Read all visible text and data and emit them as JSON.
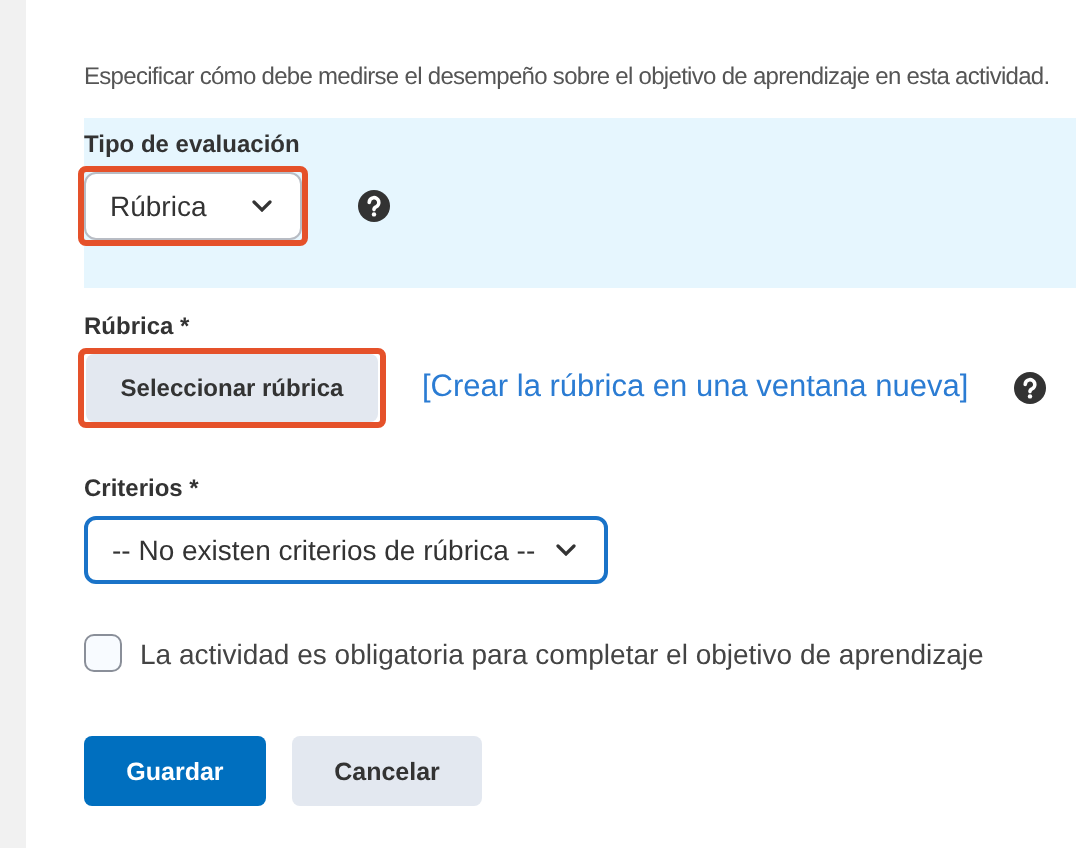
{
  "description": "Especificar cómo debe medirse el desempeño sobre el objetivo de aprendizaje en esta actividad.",
  "assessment_type": {
    "label": "Tipo de evaluación",
    "value": "Rúbrica",
    "highlighted": true
  },
  "rubric": {
    "label": "Rúbrica *",
    "button": "Seleccionar rúbrica",
    "highlighted": true,
    "link": "[Crear la rúbrica en una ventana nueva]"
  },
  "criteria": {
    "label": "Criterios *",
    "value": "-- No existen criterios de rúbrica --"
  },
  "required_checkbox": {
    "label": "La actividad es obligatoria para completar el objetivo de aprendizaje",
    "checked": false
  },
  "buttons": [
    {
      "label": "Guardar",
      "kind": "primary"
    },
    {
      "label": "Cancelar",
      "kind": "secondary"
    }
  ]
}
